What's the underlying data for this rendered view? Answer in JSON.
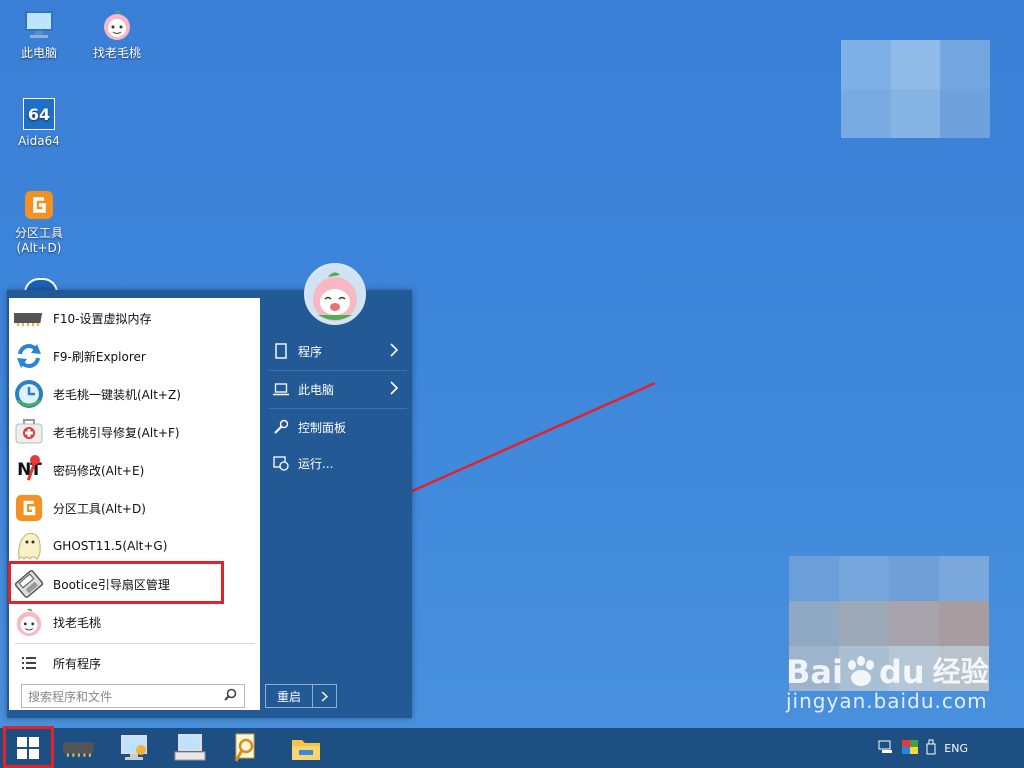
{
  "desktop": {
    "icons": [
      {
        "label": "此电脑",
        "icon": "computer-icon"
      },
      {
        "label": "找老毛桃",
        "icon": "peach-logo-icon"
      },
      {
        "label": "Aida64",
        "icon": "aida64-icon",
        "badge": "64"
      },
      {
        "label": "分区工具\n(Alt+D)",
        "icon": "partition-tool-icon"
      }
    ]
  },
  "start_menu": {
    "programs": [
      {
        "label": "F10-设置虚拟内存",
        "icon": "memory-chip-icon"
      },
      {
        "label": "F9-刷新Explorer",
        "icon": "refresh-icon"
      },
      {
        "label": "老毛桃一键装机(Alt+Z)",
        "icon": "install-clock-icon"
      },
      {
        "label": "老毛桃引导修复(Alt+F)",
        "icon": "first-aid-kit-icon"
      },
      {
        "label": "密码修改(Alt+E)",
        "icon": "password-ntpw-icon",
        "icon_text": "NT"
      },
      {
        "label": "分区工具(Alt+D)",
        "icon": "partition-tool-icon"
      },
      {
        "label": "GHOST11.5(Alt+G)",
        "icon": "ghost-icon"
      },
      {
        "label": "Bootice引导扇区管理",
        "icon": "bootice-disk-icon"
      },
      {
        "label": "找老毛桃",
        "icon": "peach-logo-icon"
      }
    ],
    "all_programs": "所有程序",
    "search_placeholder": "搜索程序和文件",
    "right_items": [
      {
        "label": "程序",
        "icon": "document-icon",
        "has_arrow": true
      },
      {
        "label": "此电脑",
        "icon": "laptop-icon",
        "has_arrow": true
      },
      {
        "label": "控制面板",
        "icon": "wrench-icon",
        "has_arrow": false
      },
      {
        "label": "运行...",
        "icon": "run-icon",
        "has_arrow": false
      }
    ],
    "restart_label": "重启"
  },
  "taskbar": {
    "items": [
      "windows-start-icon",
      "memory-chip-icon",
      "network-computer-icon",
      "keyboard-computer-icon",
      "search-document-icon",
      "file-explorer-icon"
    ],
    "tray_lang": "ENG"
  },
  "watermark": {
    "brand": "Bai",
    "brand_suffix": "du",
    "cn": "经验",
    "url": "jingyan.baidu.com"
  },
  "colors": {
    "desktop_bg": "#3d86da",
    "menu_right_bg": "#235a96",
    "taskbar_bg": "#1e4f83",
    "highlight_red": "#e3232c"
  }
}
